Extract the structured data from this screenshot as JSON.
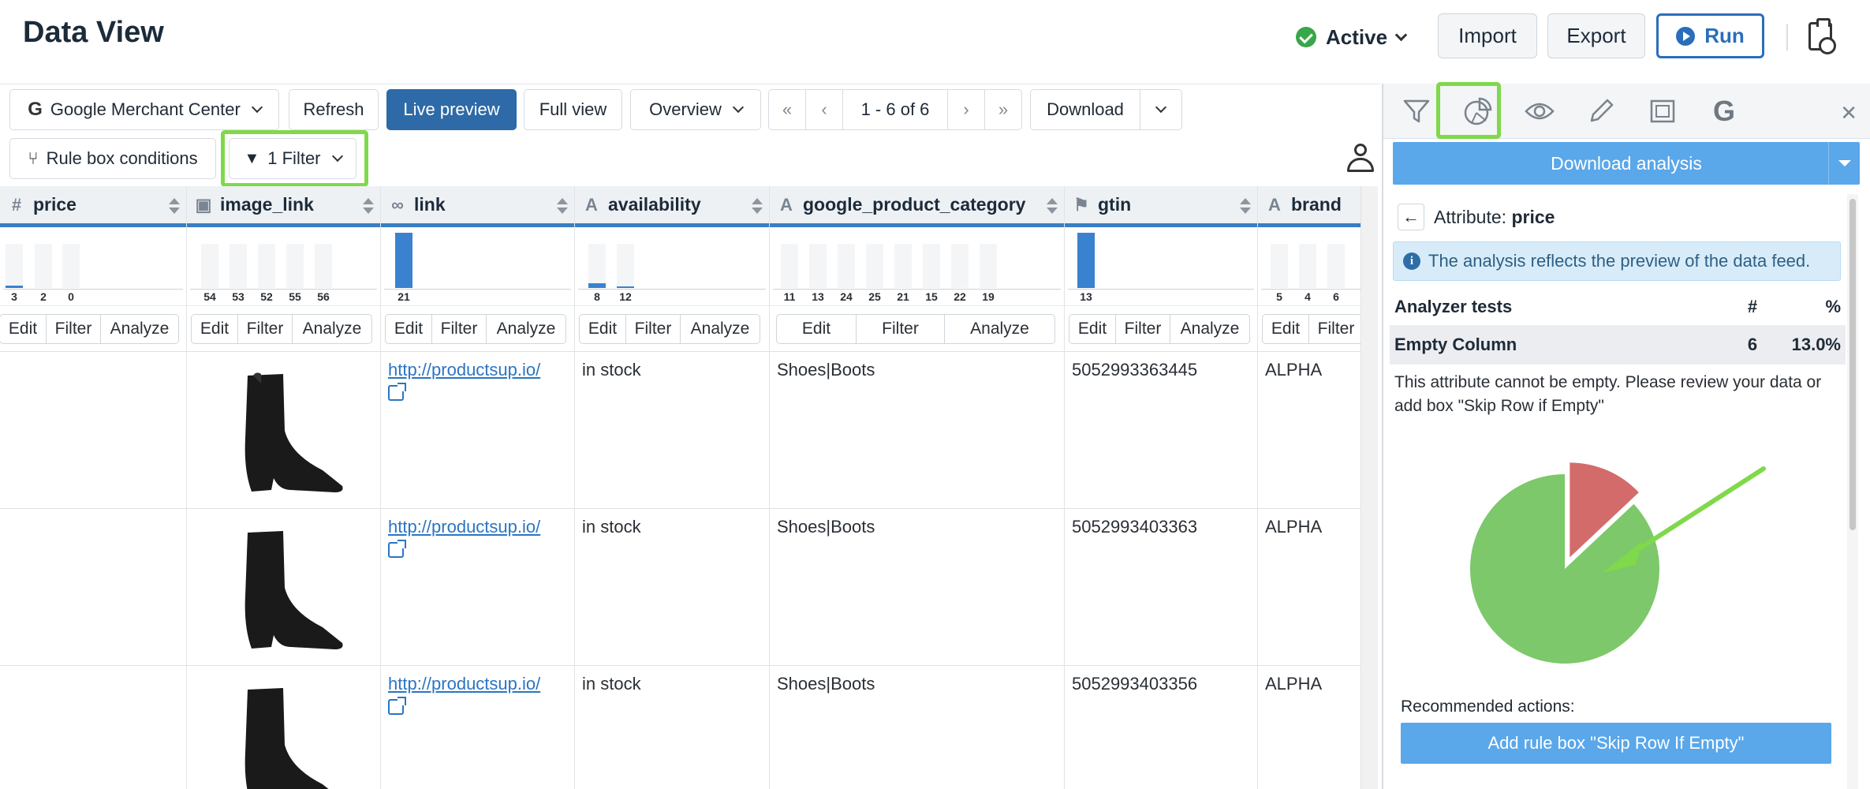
{
  "header": {
    "title": "Data View",
    "status": "Active",
    "import_label": "Import",
    "export_label": "Export",
    "run_label": "Run"
  },
  "toolbar": {
    "channel": "Google Merchant Center",
    "refresh": "Refresh",
    "live_preview": "Live preview",
    "full_view": "Full view",
    "overview": "Overview",
    "first": "«",
    "prev": "‹",
    "pagination": "1 - 6 of 6",
    "next": "›",
    "last": "»",
    "download": "Download",
    "rule_box": "Rule box conditions",
    "filter": "1 Filter"
  },
  "actions": {
    "edit": "Edit",
    "filter": "Filter",
    "analyze": "Analyze"
  },
  "columns": [
    {
      "name": "price",
      "type_icon": "#",
      "counts": [
        "3",
        "2",
        "0"
      ]
    },
    {
      "name": "image_link",
      "type_icon": "image",
      "counts": [
        "54",
        "53",
        "52",
        "55",
        "56"
      ]
    },
    {
      "name": "link",
      "type_icon": "link",
      "counts": [
        "21"
      ]
    },
    {
      "name": "availability",
      "type_icon": "A",
      "counts": [
        "8",
        "12"
      ]
    },
    {
      "name": "google_product_category",
      "type_icon": "A",
      "counts": [
        "11",
        "13",
        "24",
        "25",
        "21",
        "15",
        "22",
        "19"
      ]
    },
    {
      "name": "gtin",
      "type_icon": "flag",
      "counts": [
        "13"
      ]
    },
    {
      "name": "brand",
      "type_icon": "A",
      "counts": [
        "5",
        "4",
        "6"
      ]
    }
  ],
  "rows": [
    {
      "price": "",
      "link": "http://productsup.io/",
      "availability": "in stock",
      "category": "Shoes|Boots",
      "gtin": "5052993363445",
      "brand": "ALPHA"
    },
    {
      "price": "",
      "link": "http://productsup.io/",
      "availability": "in stock",
      "category": "Shoes|Boots",
      "gtin": "5052993403363",
      "brand": "ALPHA"
    },
    {
      "price": "",
      "link": "http://productsup.io/",
      "availability": "in stock",
      "category": "Shoes|Boots",
      "gtin": "5052993403356",
      "brand": "ALPHA"
    }
  ],
  "panel": {
    "download_analysis": "Download analysis",
    "attr_label": "Attribute:",
    "attr_name": "price",
    "info": "The analysis reflects the preview of the data feed.",
    "col_tests": "Analyzer tests",
    "col_count": "#",
    "col_pct": "%",
    "test_name": "Empty Column",
    "test_count": "6",
    "test_pct": "13.0%",
    "message": "This attribute cannot be empty. Please review your data or add box \"Skip Row if Empty\"",
    "recommended": "Recommended actions:",
    "action_button": "Add rule box \"Skip Row If Empty\""
  },
  "chart_data": {
    "type": "pie",
    "series": [
      {
        "values": [
          13.0,
          87.0
        ]
      }
    ],
    "colors": [
      "#d46b6b",
      "#7cc86a"
    ]
  },
  "colors": {
    "accent": "#2d6aa7",
    "highlight": "#7fd94a",
    "bar": "#3a82cf"
  }
}
